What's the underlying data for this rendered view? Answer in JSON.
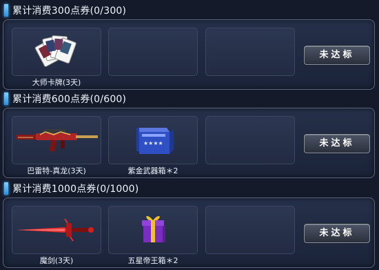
{
  "tiers": [
    {
      "title": "累计消费300点券(0/300)",
      "button_label": "未达标",
      "rewards": [
        {
          "name": "大师卡牌(3天)",
          "icon": "cards-icon"
        }
      ]
    },
    {
      "title": "累计消费600点券(0/600)",
      "button_label": "未达标",
      "rewards": [
        {
          "name": "巴雷特-真龙(3天)",
          "icon": "sniper-rifle-icon"
        },
        {
          "name": "紫金武器箱＊2",
          "icon": "weapon-crate-icon"
        }
      ]
    },
    {
      "title": "累计消费1000点券(0/1000)",
      "button_label": "未达标",
      "rewards": [
        {
          "name": "魔剑(3天)",
          "icon": "sword-icon"
        },
        {
          "name": "五星帝王箱＊2",
          "icon": "gift-box-icon"
        }
      ]
    }
  ]
}
